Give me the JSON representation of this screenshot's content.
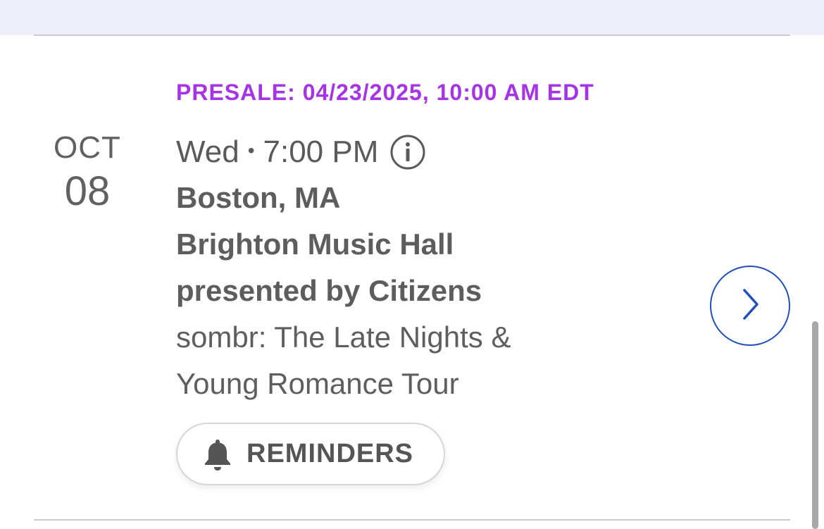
{
  "event": {
    "presale": "PRESALE: 04/23/2025, 10:00 AM EDT",
    "month": "OCT",
    "day": "08",
    "weekday": "Wed",
    "separator": "•",
    "time": "7:00 PM",
    "city": "Boston, MA",
    "venue_line1": "Brighton Music Hall",
    "venue_line2": "presented by Citizens",
    "tour_line1": "sombr: The Late Nights &",
    "tour_line2": "Young Romance Tour",
    "reminders_label": "REMINDERS"
  },
  "colors": {
    "presale": "#a634e6",
    "accent": "#1f4fbf",
    "text": "#5d5d5d"
  },
  "icons": {
    "info": "info-icon",
    "bell": "bell-icon",
    "chevron": "chevron-right-icon"
  }
}
